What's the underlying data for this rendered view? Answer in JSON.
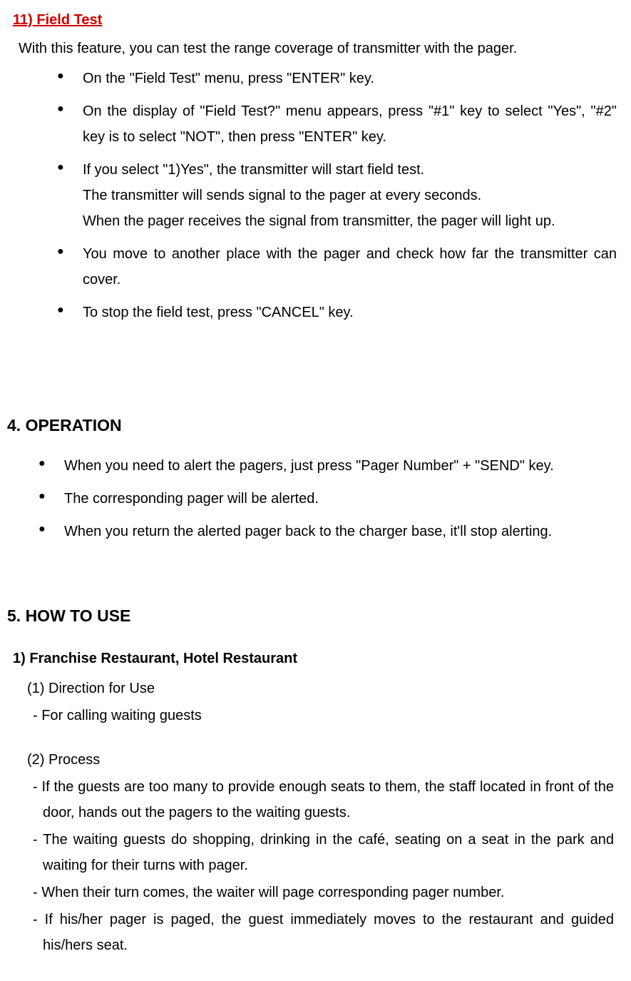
{
  "section11": {
    "title": "11) Field Test",
    "intro": "With this feature, you can test the range coverage of transmitter with the pager.",
    "items": [
      {
        "t": "On the \"Field Test\" menu, press \"ENTER\" key."
      },
      {
        "t": "On the display of \"Field Test?\" menu appears, press \"#1\" key to select \"Yes\", \"#2\" key is to select \"NOT\", then press \"ENTER\" key."
      },
      {
        "t": "If you select \"1)Yes\", the transmitter will start field test.",
        "sub": [
          "The transmitter will sends signal to the pager at every seconds.",
          "When the pager receives the signal from transmitter, the pager will light up."
        ]
      },
      {
        "t": "You move to another place with the pager and check how far the transmitter can cover."
      },
      {
        "t": "To stop the field test, press \"CANCEL\" key."
      }
    ]
  },
  "operation": {
    "heading": "4. OPERATION",
    "items": [
      {
        "t": "When you need to alert the pagers, just press \"Pager Number\" + \"SEND\" key."
      },
      {
        "t": "The corresponding pager will be alerted."
      },
      {
        "t": "When you return the alerted pager back to the charger base, it'll stop alerting."
      }
    ]
  },
  "howto": {
    "heading": "5. HOW TO USE",
    "sub1": {
      "title": "1) Franchise Restaurant, Hotel Restaurant",
      "dir_label": "(1) Direction for Use",
      "dir_item": "- For calling waiting guests",
      "proc_label": "(2) Process",
      "proc_items": [
        "- If the guests are too many to provide enough seats to them, the staff located in front of the door, hands out the pagers to the waiting guests.",
        "- The waiting guests do shopping, drinking in the café, seating on a seat in the park and waiting for their turns with pager.",
        "- When their turn comes, the waiter will page corresponding pager number.",
        "- If his/her pager is paged, the guest immediately moves to the restaurant and guided his/hers seat."
      ]
    }
  }
}
